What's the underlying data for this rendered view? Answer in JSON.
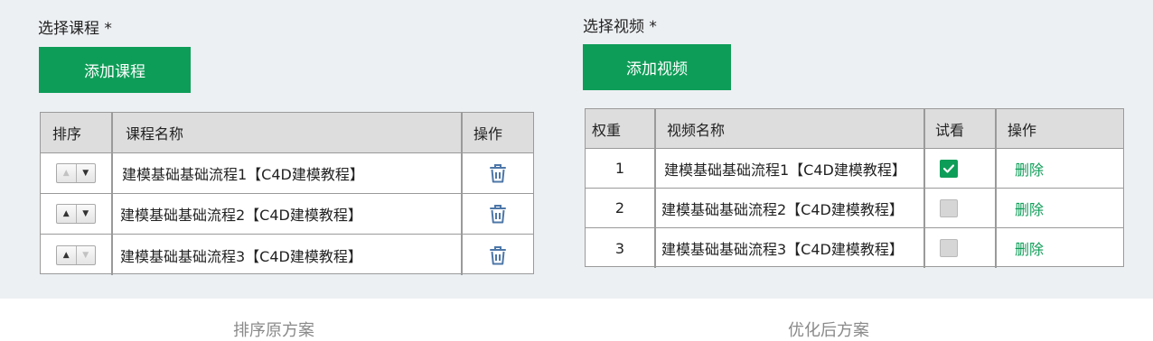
{
  "left": {
    "section_label": "选择课程 *",
    "add_button_label": "添加课程",
    "columns": {
      "sort": "排序",
      "name": "课程名称",
      "action": "操作"
    },
    "rows": [
      {
        "name": "建模基础基础流程1【C4D建模教程】",
        "up_enabled": false,
        "down_enabled": true
      },
      {
        "name": "建模基础基础流程2【C4D建模教程】",
        "up_enabled": true,
        "down_enabled": true
      },
      {
        "name": "建模基础基础流程3【C4D建模教程】",
        "up_enabled": true,
        "down_enabled": false
      }
    ],
    "caption": "排序原方案"
  },
  "right": {
    "section_label": "选择视频 *",
    "add_button_label": "添加视频",
    "columns": {
      "weight": "权重",
      "name": "视频名称",
      "trial": "试看",
      "action": "操作"
    },
    "rows": [
      {
        "weight": "1",
        "name": "建模基础基础流程1【C4D建模教程】",
        "trial": true,
        "action": "删除"
      },
      {
        "weight": "2",
        "name": "建模基础基础流程2【C4D建模教程】",
        "trial": false,
        "action": "删除"
      },
      {
        "weight": "3",
        "name": "建模基础基础流程3【C4D建模教程】",
        "trial": false,
        "action": "删除"
      }
    ],
    "caption": "优化后方案"
  },
  "colors": {
    "primary": "#0e9d58",
    "panel_bg": "#edf0f3",
    "border": "#9a9a9a",
    "header_bg": "#dddddd"
  }
}
